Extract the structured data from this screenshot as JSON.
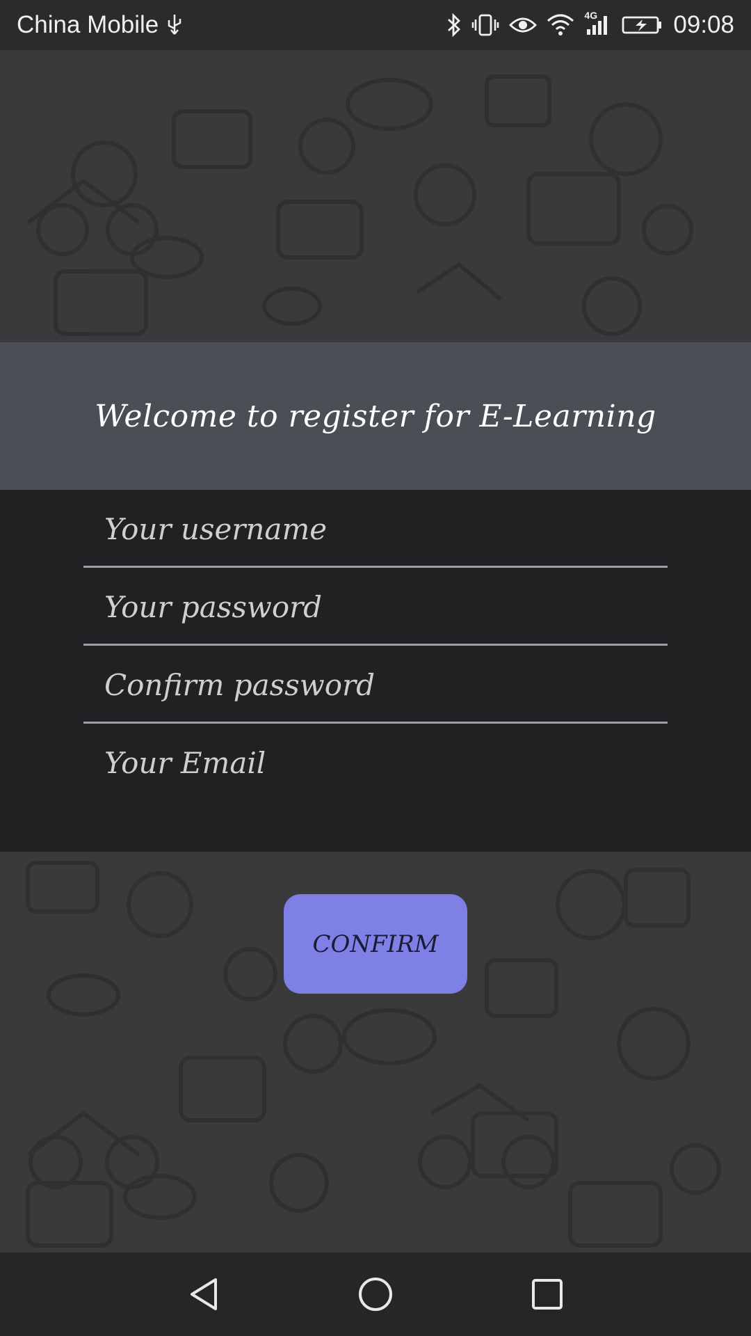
{
  "status_bar": {
    "carrier": "China Mobile",
    "network": "4G",
    "time": "09:08",
    "icons": [
      "usb-icon",
      "bluetooth-icon",
      "vibrate-icon",
      "eye-icon",
      "wifi-icon",
      "signal-icon",
      "battery-charging-icon"
    ]
  },
  "header": {
    "title": "Welcome to register for E-Learning"
  },
  "form": {
    "username": {
      "placeholder": "Your username",
      "value": ""
    },
    "password": {
      "placeholder": "Your password",
      "value": ""
    },
    "confirm_password": {
      "placeholder": "Confirm password",
      "value": ""
    },
    "email": {
      "placeholder": "Your Email",
      "value": ""
    }
  },
  "confirm_button": {
    "label": "CONFIRM"
  },
  "nav_bar": {
    "icons": [
      "back-icon",
      "home-icon",
      "recents-icon"
    ]
  },
  "colors": {
    "button": "#7f80e6",
    "header_band": "#50545c",
    "form_band": "#1e1e20",
    "underline": "#a79aa8"
  }
}
